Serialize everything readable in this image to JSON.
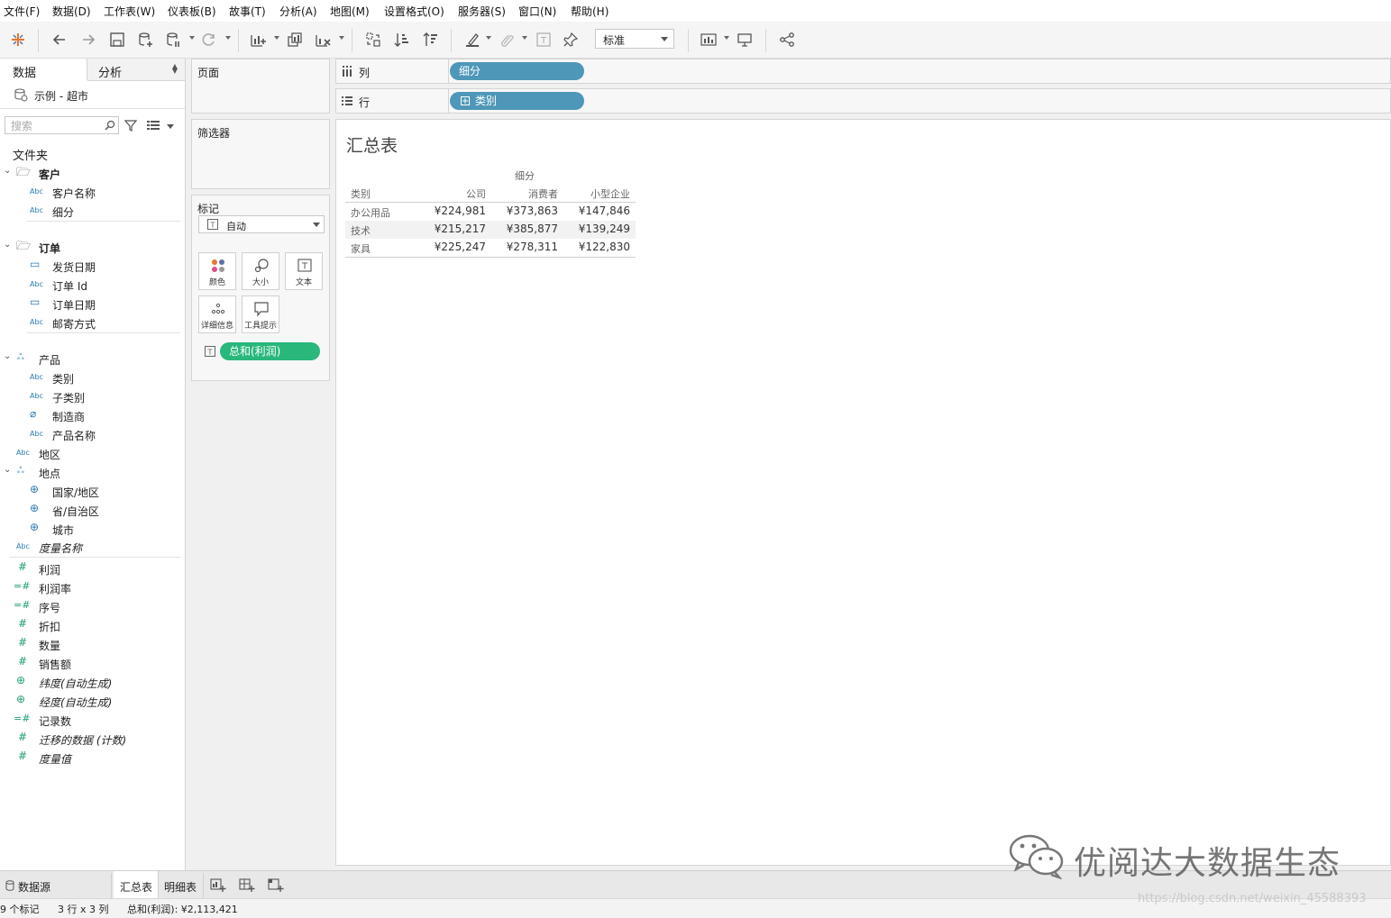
{
  "menu": [
    "文件(F)",
    "数据(D)",
    "工作表(W)",
    "仪表板(B)",
    "故事(T)",
    "分析(A)",
    "地图(M)",
    "设置格式(O)",
    "服务器(S)",
    "窗口(N)",
    "帮助(H)"
  ],
  "toolbar": {
    "zoom_value": "标准"
  },
  "datapane": {
    "tab_data": "数据",
    "tab_analysis": "分析",
    "datasource": "示例 - 超市",
    "search_placeholder": "搜索",
    "folders_label": "文件夹",
    "fields": [
      {
        "label": "客户",
        "icon": "folder-icon",
        "kind": "folder"
      },
      {
        "label": "客户名称",
        "icon": "Abc",
        "kind": "dimension"
      },
      {
        "label": "细分",
        "icon": "Abc",
        "kind": "dimension"
      },
      {
        "label": "订单",
        "icon": "folder-icon",
        "kind": "folder"
      },
      {
        "label": "发货日期",
        "icon": "calendar-icon",
        "kind": "dimension"
      },
      {
        "label": "订单 Id",
        "icon": "Abc",
        "kind": "dimension"
      },
      {
        "label": "订单日期",
        "icon": "calendar-icon",
        "kind": "dimension"
      },
      {
        "label": "邮寄方式",
        "icon": "Abc",
        "kind": "dimension"
      },
      {
        "label": "产品",
        "icon": "hierarchy-icon",
        "kind": "hierarchy"
      },
      {
        "label": "类别",
        "icon": "Abc",
        "kind": "dimension"
      },
      {
        "label": "子类别",
        "icon": "Abc",
        "kind": "dimension"
      },
      {
        "label": "制造商",
        "icon": "paperclip-icon",
        "kind": "dimension"
      },
      {
        "label": "产品名称",
        "icon": "Abc",
        "kind": "dimension"
      },
      {
        "label": "地区",
        "icon": "Abc",
        "kind": "dimension"
      },
      {
        "label": "地点",
        "icon": "hierarchy-icon",
        "kind": "hierarchy"
      },
      {
        "label": "国家/地区",
        "icon": "globe-icon",
        "kind": "dimension"
      },
      {
        "label": "省/自治区",
        "icon": "globe-icon",
        "kind": "dimension"
      },
      {
        "label": "城市",
        "icon": "globe-icon",
        "kind": "dimension"
      },
      {
        "label": "度量名称",
        "icon": "Abc",
        "kind": "dimension"
      },
      {
        "label": "利润",
        "icon": "#",
        "kind": "measure"
      },
      {
        "label": "利润率",
        "icon": "=#",
        "kind": "measure"
      },
      {
        "label": "序号",
        "icon": "=#",
        "kind": "measure"
      },
      {
        "label": "折扣",
        "icon": "#",
        "kind": "measure"
      },
      {
        "label": "数量",
        "icon": "#",
        "kind": "measure"
      },
      {
        "label": "销售额",
        "icon": "#",
        "kind": "measure"
      },
      {
        "label": "纬度(自动生成)",
        "icon": "globe-icon",
        "kind": "measure"
      },
      {
        "label": "经度(自动生成)",
        "icon": "globe-icon",
        "kind": "measure"
      },
      {
        "label": "记录数",
        "icon": "=#",
        "kind": "measure"
      },
      {
        "label": "迁移的数据 (计数)",
        "icon": "#",
        "kind": "measure"
      },
      {
        "label": "度量值",
        "icon": "#",
        "kind": "measure"
      }
    ]
  },
  "cards": {
    "pages": "页面",
    "filters": "筛选器",
    "marks": "标记",
    "marks_type": "自动",
    "mark_buttons": [
      "颜色",
      "大小",
      "文本",
      "详细信息",
      "工具提示"
    ],
    "marks_pill": "总和(利润)"
  },
  "shelves": {
    "columns_label": "列",
    "columns_pill": "细分",
    "rows_label": "行",
    "rows_pill": "类别"
  },
  "view": {
    "title": "汇总表",
    "col_header": "细分",
    "row_header": "类别",
    "columns": [
      "公司",
      "消费者",
      "小型企业"
    ],
    "rows": [
      {
        "label": "办公用品",
        "values": [
          "¥224,981",
          "¥373,863",
          "¥147,846"
        ]
      },
      {
        "label": "技术",
        "values": [
          "¥215,217",
          "¥385,877",
          "¥139,249"
        ]
      },
      {
        "label": "家具",
        "values": [
          "¥225,247",
          "¥278,311",
          "¥122,830"
        ]
      }
    ]
  },
  "sheets": {
    "datasource_tab": "数据源",
    "tabs": [
      "汇总表",
      "明细表"
    ]
  },
  "status": {
    "marks": "9 个标记",
    "dims": "3 行 x 3 列",
    "sum": "总和(利润): ¥2,113,421"
  },
  "watermark": {
    "text": "优阅达大数据生态",
    "url": "https://blog.csdn.net/weixin_45588393"
  },
  "colors": {
    "pill_blue": "#4e97b8",
    "pill_green": "#29b77c"
  }
}
